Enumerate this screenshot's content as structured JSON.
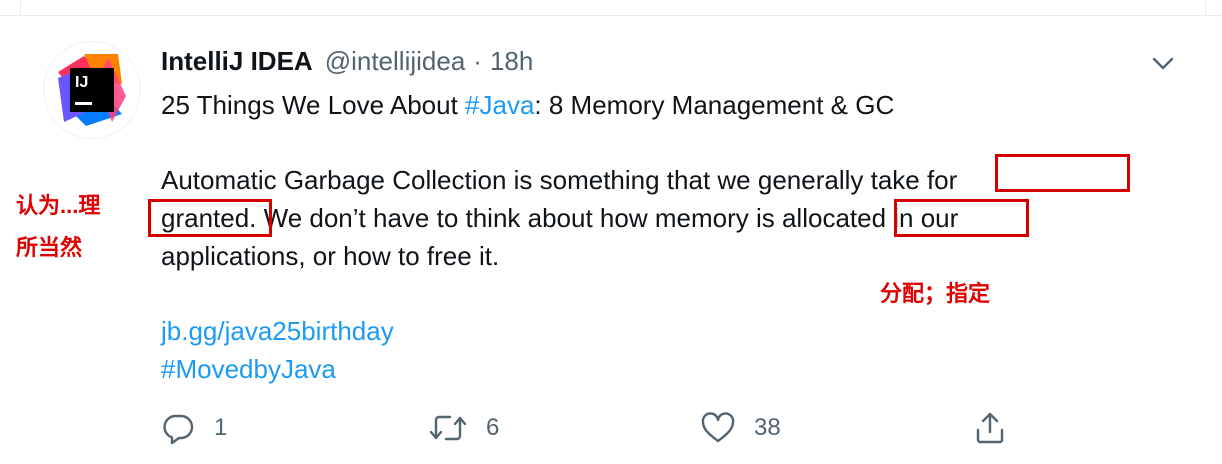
{
  "tweet": {
    "author": {
      "display_name": "IntelliJ IDEA",
      "handle": "@intellijidea",
      "separator": "·",
      "time": "18h",
      "avatar_text": "IJ"
    },
    "line1": {
      "before": "25 Things We Love About ",
      "hashtag": "#Java",
      "after": ": 8 Memory Management & GC"
    },
    "line2": "Automatic Garbage Collection is something that we generally take for",
    "line3": "granted. We don’t have to think about how memory is allocated in our",
    "line4": "applications, or how to free it.",
    "link": "jb.gg/java25birthday",
    "hashtag2": "#MovedbyJava",
    "actions": {
      "reply_count": "1",
      "retweet_count": "6",
      "like_count": "38"
    }
  },
  "annotations": {
    "note1": "认为...理",
    "note2": "所当然",
    "note3": "分配；指定",
    "highlight_color": "#d50000"
  },
  "colors": {
    "link": "#1d9bf0",
    "secondary_text": "#536471",
    "annotation": "#e00000"
  },
  "icons": [
    "intellij-logo-icon",
    "chevron-down-icon",
    "reply-icon",
    "retweet-icon",
    "like-icon",
    "share-icon"
  ]
}
